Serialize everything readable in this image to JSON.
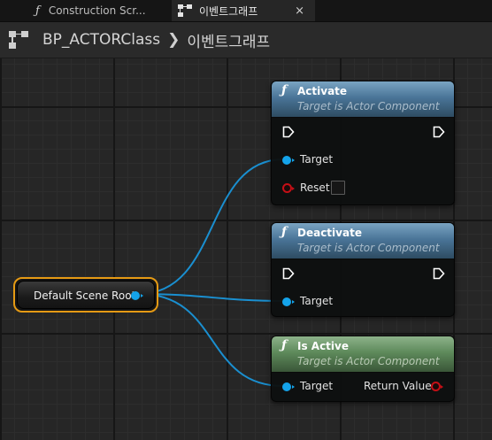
{
  "tabs": [
    {
      "icon": "function-icon",
      "glyph": "ƒ",
      "label": "Construction Scr...",
      "active": false
    },
    {
      "icon": "event-graph-icon",
      "label": "이벤트그래프",
      "active": true,
      "close": "×"
    }
  ],
  "header": {
    "class_name": "BP_ACTORClass",
    "separator": "❯",
    "graph_name": "이벤트그래프"
  },
  "variable_node": {
    "label": "Default Scene Root"
  },
  "nodes": {
    "activate": {
      "glyph": "ƒ",
      "title": "Activate",
      "subtitle": "Target is Actor Component",
      "pins": {
        "target": "Target",
        "reset": "Reset"
      }
    },
    "deactivate": {
      "glyph": "ƒ",
      "title": "Deactivate",
      "subtitle": "Target is Actor Component",
      "pins": {
        "target": "Target"
      }
    },
    "is_active": {
      "glyph": "ƒ",
      "title": "Is Active",
      "subtitle": "Target is Actor Component",
      "pins": {
        "target": "Target",
        "return_value": "Return Value"
      }
    }
  },
  "colors": {
    "object_pin": "#14a3ea",
    "bool_pin": "#c40f16",
    "variable_border": "#e59a14",
    "function_header": "#4a7598",
    "pure_function_header": "#5e8a5b"
  }
}
